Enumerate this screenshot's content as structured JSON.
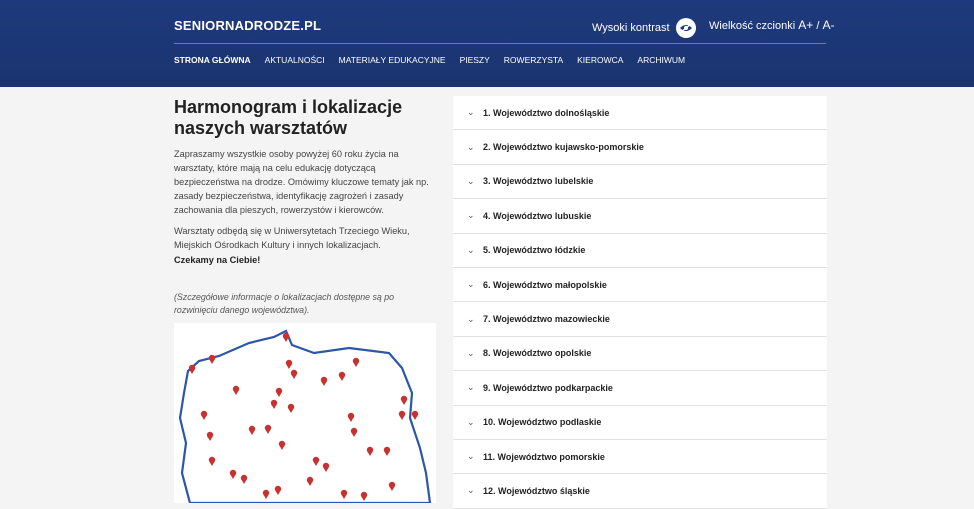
{
  "header": {
    "logo": "SENIORNADRODZE.PL",
    "contrast_label": "Wysoki kontrast",
    "font_label": "Wielkość czcionki",
    "font_increase": "A+",
    "font_sep": "/",
    "font_decrease": "A-"
  },
  "nav": [
    {
      "label": "STRONA GŁÓWNA"
    },
    {
      "label": "AKTUALNOŚCI"
    },
    {
      "label": "MATERIAŁY EDUKACYJNE"
    },
    {
      "label": "PIESZY"
    },
    {
      "label": "ROWERZYSTA"
    },
    {
      "label": "KIEROWCA"
    },
    {
      "label": "ARCHIWUM"
    }
  ],
  "main": {
    "title": "Harmonogram i lokalizacje naszych warsztatów",
    "p1": "Zapraszamy wszystkie osoby powyżej 60 roku życia na warsztaty, które mają na celu edukację dotyczącą bezpieczeństwa na drodze. Omówimy kluczowe tematy jak np. zasady bezpieczeństwa, identyfikację zagrożeń i zasady zachowania dla pieszych, rowerzystów i kierowców.",
    "p2": "Warsztaty odbędą się w Uniwersytetach Trzeciego Wieku, Miejskich Ośrodkach Kultury i innych lokalizacjach.",
    "p3": "Czekamy na Ciebie!",
    "note": "(Szczegółowe informacje o lokalizacjach dostępne są po rozwinięciu danego województwa)."
  },
  "accordion": [
    {
      "label": "1. Województwo dolnośląskie"
    },
    {
      "label": "2. Województwo kujawsko-pomorskie"
    },
    {
      "label": "3. Województwo lubelskie"
    },
    {
      "label": "4. Województwo lubuskie"
    },
    {
      "label": "5. Województwo łódzkie"
    },
    {
      "label": "6. Województwo małopolskie"
    },
    {
      "label": "7. Województwo mazowieckie"
    },
    {
      "label": "8. Województwo opolskie"
    },
    {
      "label": "9. Województwo podkarpackie"
    },
    {
      "label": "10. Województwo podlaskie"
    },
    {
      "label": "11. Województwo pomorskie"
    },
    {
      "label": "12. Województwo śląskie"
    }
  ],
  "colors": {
    "header": "#1f3a7c",
    "pin": "#c8312f",
    "map_outline": "#2c57a8"
  }
}
